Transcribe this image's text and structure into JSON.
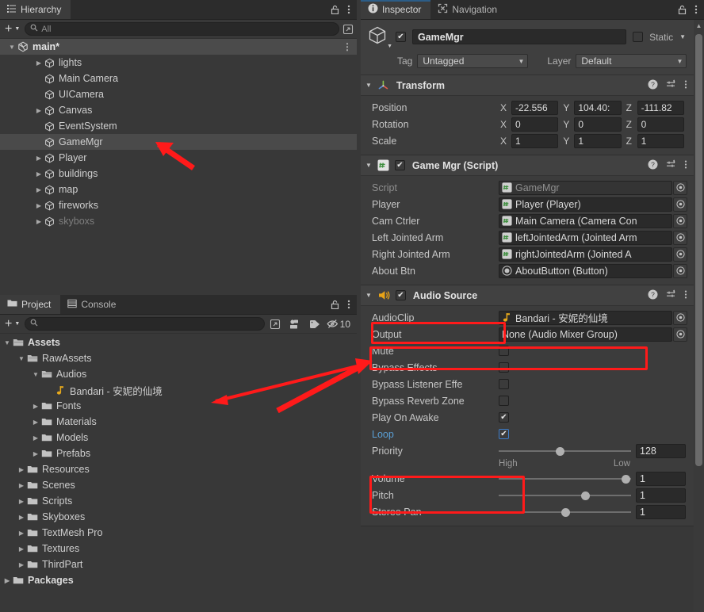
{
  "hierarchy": {
    "tab_label": "Hierarchy",
    "tab_icon": "hierarchy-icon",
    "lock_icon": "lock-icon",
    "menu_icon": "kebab-menu-icon",
    "add_label": "+",
    "search_placeholder": "All",
    "items": [
      {
        "label": "main*",
        "depth": 0,
        "twisty": "down",
        "icon": "unity-scene-icon",
        "scene": true,
        "selected": false,
        "dim": false
      },
      {
        "label": "lights",
        "depth": 2,
        "twisty": "right",
        "icon": "gameobject-icon",
        "scene": false,
        "selected": false,
        "dim": false
      },
      {
        "label": "Main Camera",
        "depth": 2,
        "twisty": "none",
        "icon": "gameobject-icon",
        "scene": false,
        "selected": false,
        "dim": false
      },
      {
        "label": "UICamera",
        "depth": 2,
        "twisty": "none",
        "icon": "gameobject-icon",
        "scene": false,
        "selected": false,
        "dim": false
      },
      {
        "label": "Canvas",
        "depth": 2,
        "twisty": "right",
        "icon": "gameobject-icon",
        "scene": false,
        "selected": false,
        "dim": false
      },
      {
        "label": "EventSystem",
        "depth": 2,
        "twisty": "none",
        "icon": "gameobject-icon",
        "scene": false,
        "selected": false,
        "dim": false
      },
      {
        "label": "GameMgr",
        "depth": 2,
        "twisty": "none",
        "icon": "gameobject-icon",
        "scene": false,
        "selected": true,
        "dim": false
      },
      {
        "label": "Player",
        "depth": 2,
        "twisty": "right",
        "icon": "gameobject-icon",
        "scene": false,
        "selected": false,
        "dim": false
      },
      {
        "label": "buildings",
        "depth": 2,
        "twisty": "right",
        "icon": "gameobject-icon",
        "scene": false,
        "selected": false,
        "dim": false
      },
      {
        "label": "map",
        "depth": 2,
        "twisty": "right",
        "icon": "gameobject-icon",
        "scene": false,
        "selected": false,
        "dim": false
      },
      {
        "label": "fireworks",
        "depth": 2,
        "twisty": "right",
        "icon": "gameobject-icon",
        "scene": false,
        "selected": false,
        "dim": false
      },
      {
        "label": "skyboxs",
        "depth": 2,
        "twisty": "right",
        "icon": "gameobject-icon",
        "scene": false,
        "selected": false,
        "dim": true
      }
    ]
  },
  "project": {
    "tabs": [
      {
        "label": "Project",
        "icon": "folder-icon",
        "active": true
      },
      {
        "label": "Console",
        "icon": "console-icon",
        "active": false
      }
    ],
    "lock_icon": "lock-icon",
    "menu_icon": "kebab-menu-icon",
    "add_label": "+",
    "search_placeholder": "",
    "toolbar_icons": [
      "open-in-new-icon",
      "filter-by-type-icon",
      "filter-by-label-icon",
      "hidden-packages-icon"
    ],
    "hidden_count": "10",
    "items": [
      {
        "label": "Assets",
        "depth": 0,
        "twisty": "down",
        "icon": "folder-open-icon",
        "bold": true
      },
      {
        "label": "RawAssets",
        "depth": 1,
        "twisty": "down",
        "icon": "folder-open-icon",
        "bold": false
      },
      {
        "label": "Audios",
        "depth": 2,
        "twisty": "down",
        "icon": "folder-open-icon",
        "bold": false
      },
      {
        "label": "Bandari - 安妮的仙境",
        "depth": 3,
        "twisty": "none",
        "icon": "audio-clip-icon",
        "bold": false
      },
      {
        "label": "Fonts",
        "depth": 2,
        "twisty": "right",
        "icon": "folder-icon",
        "bold": false
      },
      {
        "label": "Materials",
        "depth": 2,
        "twisty": "right",
        "icon": "folder-icon",
        "bold": false
      },
      {
        "label": "Models",
        "depth": 2,
        "twisty": "right",
        "icon": "folder-icon",
        "bold": false
      },
      {
        "label": "Prefabs",
        "depth": 2,
        "twisty": "right",
        "icon": "folder-icon",
        "bold": false
      },
      {
        "label": "Resources",
        "depth": 1,
        "twisty": "right",
        "icon": "folder-icon",
        "bold": false
      },
      {
        "label": "Scenes",
        "depth": 1,
        "twisty": "right",
        "icon": "folder-icon",
        "bold": false
      },
      {
        "label": "Scripts",
        "depth": 1,
        "twisty": "right",
        "icon": "folder-icon",
        "bold": false
      },
      {
        "label": "Skyboxes",
        "depth": 1,
        "twisty": "right",
        "icon": "folder-icon",
        "bold": false
      },
      {
        "label": "TextMesh Pro",
        "depth": 1,
        "twisty": "right",
        "icon": "folder-icon",
        "bold": false
      },
      {
        "label": "Textures",
        "depth": 1,
        "twisty": "right",
        "icon": "folder-icon",
        "bold": false
      },
      {
        "label": "ThirdPart",
        "depth": 1,
        "twisty": "right",
        "icon": "folder-icon",
        "bold": false
      },
      {
        "label": "Packages",
        "depth": 0,
        "twisty": "right",
        "icon": "folder-icon",
        "bold": true
      }
    ]
  },
  "inspector": {
    "tabs": [
      {
        "label": "Inspector",
        "icon": "info-icon",
        "active": true
      },
      {
        "label": "Navigation",
        "icon": "navigation-icon",
        "active": false
      }
    ],
    "lock_icon": "lock-icon",
    "menu_icon": "kebab-menu-icon",
    "object": {
      "icon": "gameobject-icon",
      "enabled": true,
      "name": "GameMgr",
      "static_label": "Static",
      "static_checked": false,
      "tag_label": "Tag",
      "tag_value": "Untagged",
      "layer_label": "Layer",
      "layer_value": "Default"
    },
    "components": [
      {
        "title": "Transform",
        "icon": "transform-icon",
        "expanded": true,
        "has_checkbox": false,
        "header_icons": [
          "help-icon",
          "preset-icon",
          "kebab-menu-icon"
        ],
        "rows": [
          {
            "type": "vec3",
            "label": "Position",
            "x": "-22.556",
            "y": "104.40:",
            "z": "-111.82"
          },
          {
            "type": "vec3",
            "label": "Rotation",
            "x": "0",
            "y": "0",
            "z": "0"
          },
          {
            "type": "vec3",
            "label": "Scale",
            "x": "1",
            "y": "1",
            "z": "1"
          }
        ]
      },
      {
        "title": "Game Mgr (Script)",
        "icon": "script-icon",
        "expanded": true,
        "has_checkbox": true,
        "checked": true,
        "header_icons": [
          "help-icon",
          "preset-icon",
          "kebab-menu-icon"
        ],
        "rows": [
          {
            "type": "object",
            "label": "Script",
            "value": "GameMgr",
            "value_icon": "script-icon",
            "disabled": true
          },
          {
            "type": "object",
            "label": "Player",
            "value": "Player (Player)",
            "value_icon": "script-icon",
            "disabled": false
          },
          {
            "type": "object",
            "label": "Cam Ctrler",
            "value": "Main Camera (Camera Con",
            "value_icon": "script-icon",
            "disabled": false
          },
          {
            "type": "object",
            "label": "Left Jointed Arm",
            "value": "leftJointedArm (Jointed Arm",
            "value_icon": "script-icon",
            "disabled": false
          },
          {
            "type": "object",
            "label": "Right Jointed Arm",
            "value": "rightJointedArm (Jointed A",
            "value_icon": "script-icon",
            "disabled": false
          },
          {
            "type": "object",
            "label": "About Btn",
            "value": "AboutButton (Button)",
            "value_icon": "component-icon",
            "disabled": false
          }
        ]
      },
      {
        "title": "Audio Source",
        "icon": "audio-source-icon",
        "expanded": true,
        "has_checkbox": true,
        "checked": true,
        "header_icons": [
          "help-icon",
          "preset-icon",
          "kebab-menu-icon"
        ],
        "rows": [
          {
            "type": "object",
            "label": "AudioClip",
            "value": "Bandari - 安妮的仙境",
            "value_icon": "audio-clip-icon",
            "disabled": false
          },
          {
            "type": "object",
            "label": "Output",
            "value": "None (Audio Mixer Group)",
            "value_icon": "none",
            "disabled": false
          },
          {
            "type": "checkbox",
            "label": "Mute",
            "checked": false
          },
          {
            "type": "checkbox",
            "label": "Bypass Effects",
            "checked": false
          },
          {
            "type": "checkbox",
            "label": "Bypass Listener Effe",
            "checked": false
          },
          {
            "type": "checkbox",
            "label": "Bypass Reverb Zone",
            "checked": false
          },
          {
            "type": "checkbox",
            "label": "Play On Awake",
            "checked": true
          },
          {
            "type": "checkbox",
            "label": "Loop",
            "checked": true,
            "label_color": "blue"
          },
          {
            "type": "slider",
            "label": "Priority",
            "value": "128",
            "pos": 0.46,
            "left_hint": "High",
            "right_hint": "Low"
          },
          {
            "type": "slider",
            "label": "Volume",
            "value": "1",
            "pos": 0.96
          },
          {
            "type": "slider",
            "label": "Pitch",
            "value": "1",
            "pos": 0.65
          },
          {
            "type": "slider",
            "label": "Stereo Pan",
            "value": "1",
            "pos": 0.5
          }
        ]
      }
    ]
  },
  "annotations": {
    "color": "#ff1a1a",
    "highlight_boxes": [
      "audio-source-header",
      "audioclip-row",
      "play-on-awake-and-loop"
    ],
    "arrows": [
      "arrow-to-gamemgr-hierarchy",
      "arrow-to-bandari-project",
      "arrow-to-audioclip-field"
    ]
  }
}
